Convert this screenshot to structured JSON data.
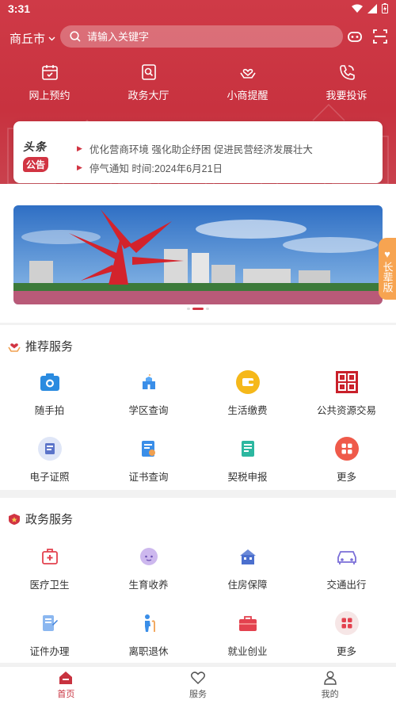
{
  "status": {
    "time": "3:31"
  },
  "header": {
    "city": "商丘市",
    "search_placeholder": "请输入关键字"
  },
  "quick_actions": [
    {
      "label": "网上预约",
      "icon": "calendar-icon"
    },
    {
      "label": "政务大厅",
      "icon": "search-doc-icon"
    },
    {
      "label": "小商提醒",
      "icon": "hands-heart-icon"
    },
    {
      "label": "我要投诉",
      "icon": "phone-icon"
    }
  ],
  "notice": {
    "badge_top": "头条",
    "badge_bottom": "公告",
    "items": [
      "优化营商环境 强化助企纾困 促进民营经济发展壮大",
      "停气通知 时间:2024年6月21日"
    ]
  },
  "elder_mode": {
    "label": "长辈版"
  },
  "recommended": {
    "title": "推荐服务",
    "items": [
      {
        "label": "随手拍",
        "icon": "camera-icon"
      },
      {
        "label": "学区查询",
        "icon": "school-icon"
      },
      {
        "label": "生活缴费",
        "icon": "wallet-icon"
      },
      {
        "label": "公共资源交易",
        "icon": "seal-icon"
      },
      {
        "label": "电子证照",
        "icon": "id-card-icon"
      },
      {
        "label": "证书查询",
        "icon": "certificate-icon"
      },
      {
        "label": "契税申报",
        "icon": "tax-doc-icon"
      },
      {
        "label": "更多",
        "icon": "more-icon"
      }
    ]
  },
  "gov": {
    "title": "政务服务",
    "items": [
      {
        "label": "医疗卫生",
        "icon": "medical-kit-icon"
      },
      {
        "label": "生育收养",
        "icon": "baby-icon"
      },
      {
        "label": "住房保障",
        "icon": "house-icon"
      },
      {
        "label": "交通出行",
        "icon": "car-icon"
      },
      {
        "label": "证件办理",
        "icon": "document-icon"
      },
      {
        "label": "离职退休",
        "icon": "elder-icon"
      },
      {
        "label": "就业创业",
        "icon": "briefcase-icon"
      },
      {
        "label": "更多",
        "icon": "more-icon"
      }
    ]
  },
  "tabs": [
    {
      "label": "首页",
      "icon": "home-icon"
    },
    {
      "label": "服务",
      "icon": "heart-icon"
    },
    {
      "label": "我的",
      "icon": "user-icon"
    }
  ],
  "colors": {
    "brand": "#c8323f",
    "accent_orange": "#f7a451"
  }
}
